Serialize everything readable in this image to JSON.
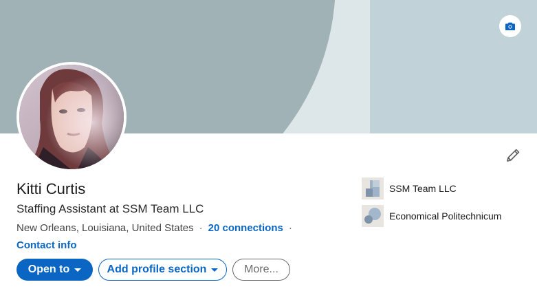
{
  "profile": {
    "name": "Kitti Curtis",
    "headline": "Staffing Assistant at SSM Team LLC",
    "location": "New Orleans, Louisiana, United States",
    "separator": "·",
    "connections": "20 connections",
    "contact_info": "Contact info"
  },
  "actions": {
    "open_to": "Open to",
    "add_section": "Add profile section",
    "more": "More..."
  },
  "organizations": [
    {
      "name": "SSM Team LLC",
      "icon": "company-logo"
    },
    {
      "name": "Economical Politechnicum",
      "icon": "school-logo"
    }
  ],
  "icons": {
    "camera": "camera-icon",
    "edit": "pencil-icon"
  },
  "colors": {
    "accent": "#0a66c2",
    "banner_dark": "#a0b2b6",
    "banner_light": "#dde6e8",
    "banner_right": "#c1d3d8"
  }
}
